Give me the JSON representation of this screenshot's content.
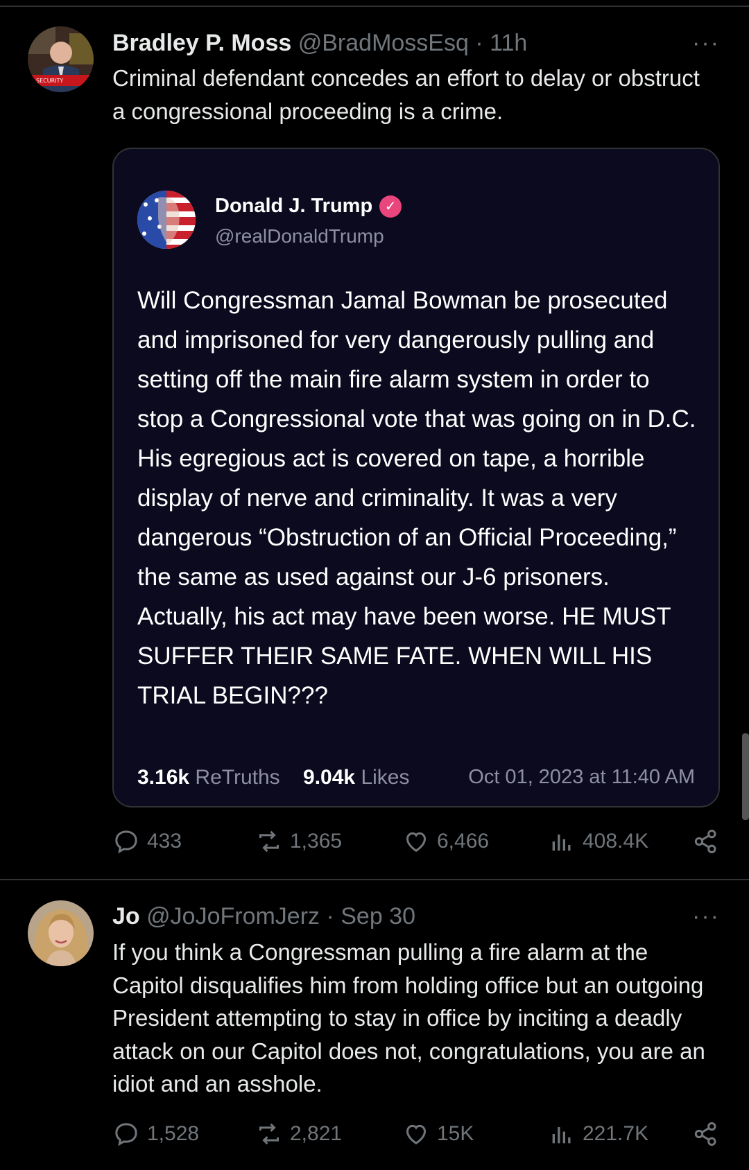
{
  "tweets": [
    {
      "author_name": "Bradley P. Moss",
      "handle_time": "@BradMossEsq · 11h",
      "more": "···",
      "text": "Criminal defendant concedes an effort to delay or obstruct a congressional proceeding is a crime.",
      "avatar_label": "SECURITY",
      "quote": {
        "author_name": "Donald J. Trump",
        "verified": "✓",
        "handle": "@realDonaldTrump",
        "text": "Will Congressman Jamal Bowman be prosecuted and imprisoned for very dangerously pulling and setting off the main fire alarm system in order to stop a Congressional vote that was going on in D.C. His egregious act is covered on tape, a horrible display of nerve and criminality. It was a very dangerous “Obstruction of an Official Proceeding,” the same as used against our J-6 prisoners. Actually, his act may have been worse. HE MUST SUFFER THEIR SAME FATE. WHEN WILL HIS TRIAL BEGIN???",
        "retruths_count": "3.16k",
        "retruths_label": "ReTruths",
        "likes_count": "9.04k",
        "likes_label": "Likes",
        "date": "Oct 01, 2023 at 11:40 AM"
      },
      "actions": {
        "replies": "433",
        "reposts": "1,365",
        "likes": "6,466",
        "views": "408.4K"
      }
    },
    {
      "author_name": "Jo",
      "handle_time": "@JoJoFromJerz · Sep 30",
      "more": "···",
      "text": "If you think a Congressman pulling a fire alarm at the Capitol disqualifies him from holding office but an outgoing President attempting to stay in office by inciting a deadly attack on our Capitol does not, congratulations, you are an idiot and an asshole.",
      "actions": {
        "replies": "1,528",
        "reposts": "2,821",
        "likes": "15K",
        "views": "221.7K"
      }
    }
  ],
  "icons": [
    "reply-icon",
    "repost-icon",
    "like-icon",
    "views-icon",
    "share-icon",
    "more-icon",
    "verified-icon"
  ],
  "colors": {
    "background": "#000000",
    "text": "#e7e9ea",
    "muted": "#71767b",
    "quote_bg": "#0b0a1e",
    "verified_badge": "#e8467c",
    "divider": "#2f3336"
  }
}
